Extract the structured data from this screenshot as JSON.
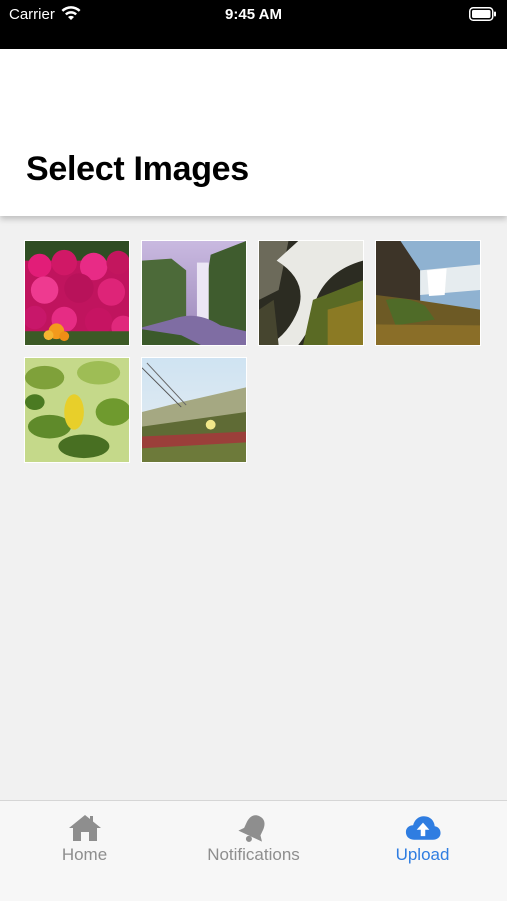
{
  "status_bar": {
    "carrier": "Carrier",
    "time": "9:45 AM"
  },
  "header": {
    "title": "Select Images"
  },
  "images": [
    {
      "icon": "image-thumbnail"
    },
    {
      "icon": "image-thumbnail"
    },
    {
      "icon": "image-thumbnail"
    },
    {
      "icon": "image-thumbnail"
    },
    {
      "icon": "image-thumbnail"
    },
    {
      "icon": "image-thumbnail"
    }
  ],
  "tabs": [
    {
      "label": "Home",
      "icon": "home-icon",
      "active": false
    },
    {
      "label": "Notifications",
      "icon": "bell-icon",
      "active": false
    },
    {
      "label": "Upload",
      "icon": "cloud-upload-icon",
      "active": true
    }
  ],
  "colors": {
    "active_tab": "#2f7de1",
    "inactive_tab": "#8e8e8e",
    "background": "#f1f1f1"
  }
}
